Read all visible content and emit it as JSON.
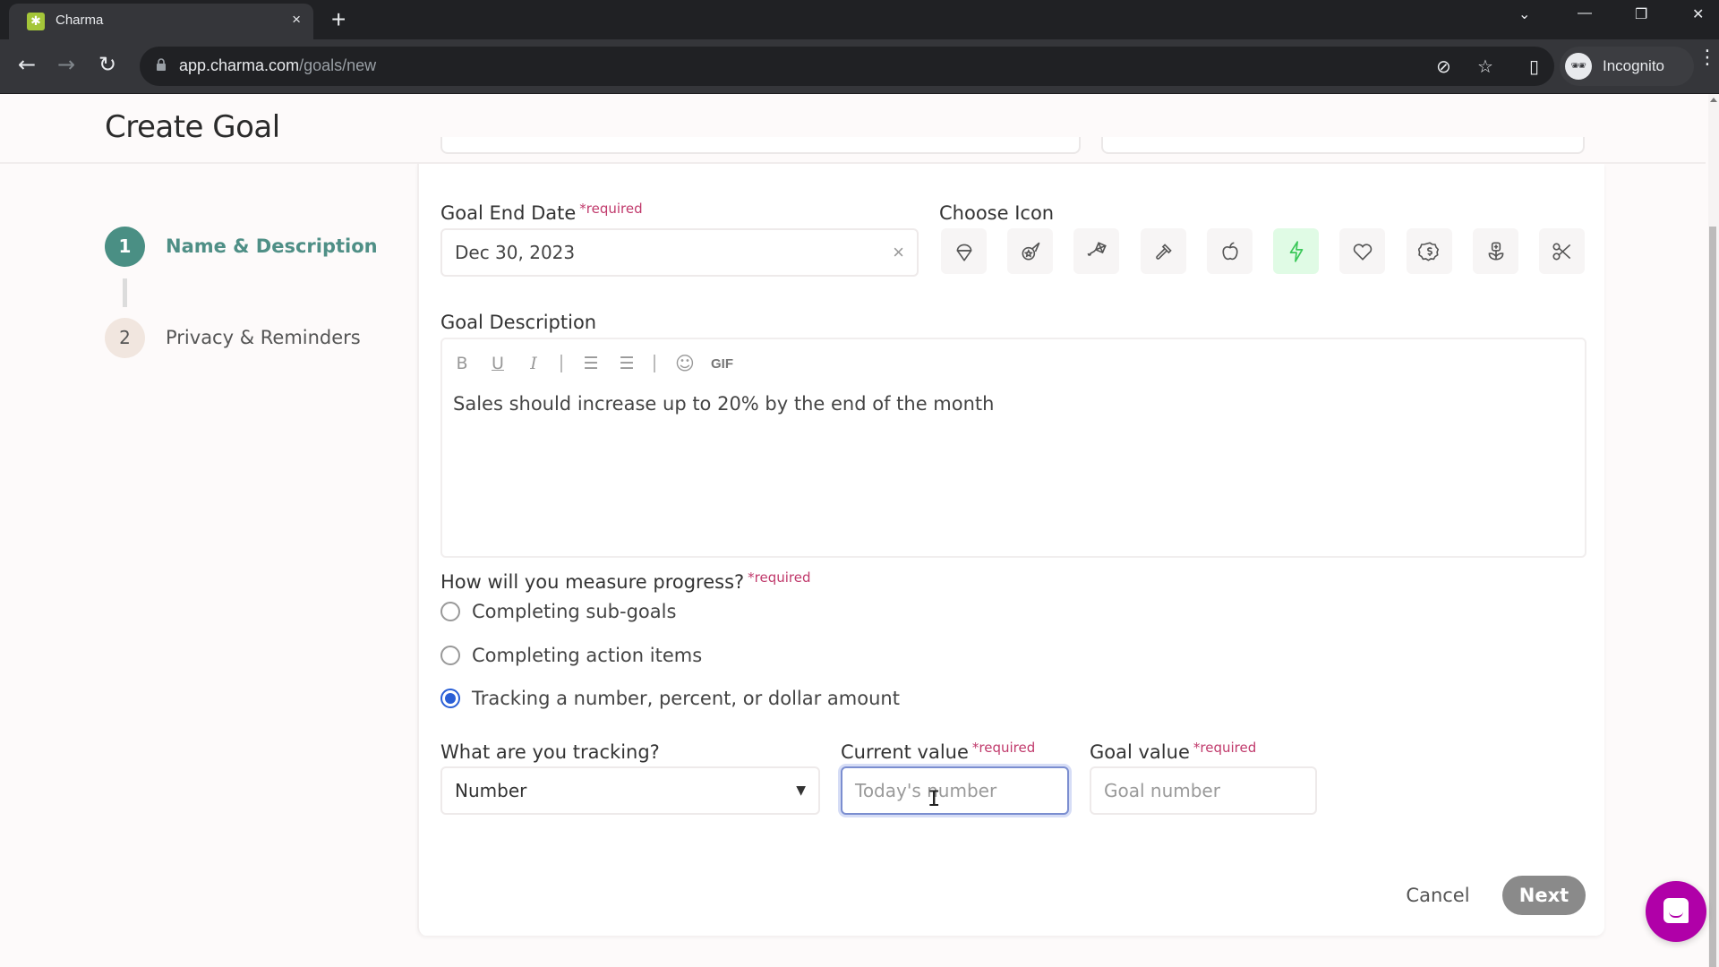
{
  "browser": {
    "tab_title": "Charma",
    "tab_close": "×",
    "new_tab": "+",
    "url_host": "app.charma.com",
    "url_path": "/goals/new",
    "profile_label": "Incognito",
    "icons": {
      "back": "←",
      "forward": "→",
      "reload": "↻",
      "eye_off": "⊘",
      "star": "☆",
      "side_panel": "▯",
      "menu": "⋮",
      "tab_search": "⌄",
      "minimize": "—",
      "restore": "❐",
      "close": "✕"
    }
  },
  "page": {
    "title": "Create Goal"
  },
  "steps": [
    {
      "number": "1",
      "label": "Name & Description",
      "state": "active"
    },
    {
      "number": "2",
      "label": "Privacy & Reminders",
      "state": "pending"
    }
  ],
  "form": {
    "required_marker": "*required",
    "end_date": {
      "label": "Goal End Date",
      "value": "Dec 30, 2023",
      "clear_icon": "×"
    },
    "choose_icon": {
      "label": "Choose Icon",
      "icons": [
        "ice-cream",
        "comet",
        "kite",
        "hammer",
        "apple",
        "lightning",
        "heart",
        "dollar-badge",
        "flower-pot",
        "scissors"
      ],
      "selected": "lightning",
      "selected_bg": "#e0fbe5",
      "selected_color": "#3cc85a"
    },
    "description": {
      "label": "Goal Description",
      "toolbar": {
        "bold": "B",
        "underline": "U",
        "italic": "I",
        "bullet_list": "☰",
        "numbered_list": "☰",
        "emoji": "☺",
        "gif": "GIF"
      },
      "text": "Sales should increase up to 20% by the end of the month"
    },
    "measure": {
      "label": "How will you measure progress?",
      "options": [
        {
          "label": "Completing sub-goals",
          "checked": false
        },
        {
          "label": "Completing action items",
          "checked": false
        },
        {
          "label": "Tracking a number, percent, or dollar amount",
          "checked": true
        }
      ]
    },
    "tracking": {
      "label": "What are you tracking?",
      "value": "Number",
      "caret": "▼"
    },
    "current_value": {
      "label": "Current value",
      "placeholder": "Today's number",
      "value": ""
    },
    "goal_value": {
      "label": "Goal value",
      "placeholder": "Goal number",
      "value": ""
    }
  },
  "actions": {
    "cancel": "Cancel",
    "next": "Next"
  },
  "colors": {
    "accent_teal": "#4a8f84",
    "required_pink": "#c0396b",
    "radio_blue": "#2a5fd6",
    "chat_purple": "#b000a8",
    "next_disabled": "#8a8a8a"
  }
}
